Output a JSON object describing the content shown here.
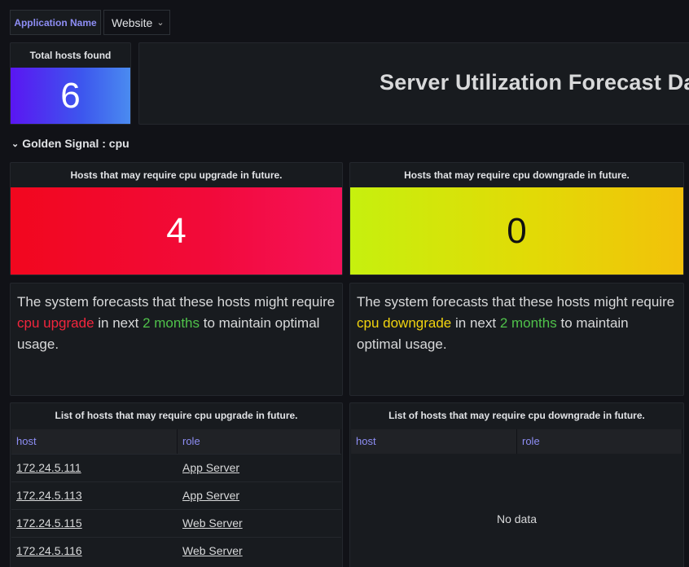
{
  "variables": {
    "app_label": "Application Name",
    "app_value": "Website"
  },
  "total_hosts": {
    "title": "Total hosts found",
    "value": "6"
  },
  "dashboard_title": "Server Utilization Forecast Da",
  "row": {
    "title": "Golden Signal : cpu"
  },
  "upgrade": {
    "title": "Hosts that may require cpu upgrade in future.",
    "value": "4",
    "color": "#f2071e",
    "text_pre": "The system forecasts that these hosts might require ",
    "text_highlight": "cpu upgrade",
    "text_mid": " in next ",
    "text_period": "2 months",
    "text_post": " to maintain optimal usage.",
    "table_title": "List of hosts that may require cpu upgrade in future.",
    "columns": [
      "host",
      "role"
    ],
    "rows": [
      {
        "host": "172.24.5.111",
        "role": "App Server"
      },
      {
        "host": "172.24.5.113",
        "role": "App Server"
      },
      {
        "host": "172.24.5.115",
        "role": "Web Server"
      },
      {
        "host": "172.24.5.116",
        "role": "Web Server"
      }
    ]
  },
  "downgrade": {
    "title": "Hosts that may require cpu downgrade in future.",
    "value": "0",
    "color": "#e2da06",
    "text_pre": "The system forecasts that these hosts might require ",
    "text_highlight": "cpu downgrade",
    "text_mid": " in next ",
    "text_period": "2 months",
    "text_post": " to maintain optimal usage.",
    "table_title": "List of hosts that may require cpu downgrade in future.",
    "columns": [
      "host",
      "role"
    ],
    "empty_text": "No data"
  }
}
